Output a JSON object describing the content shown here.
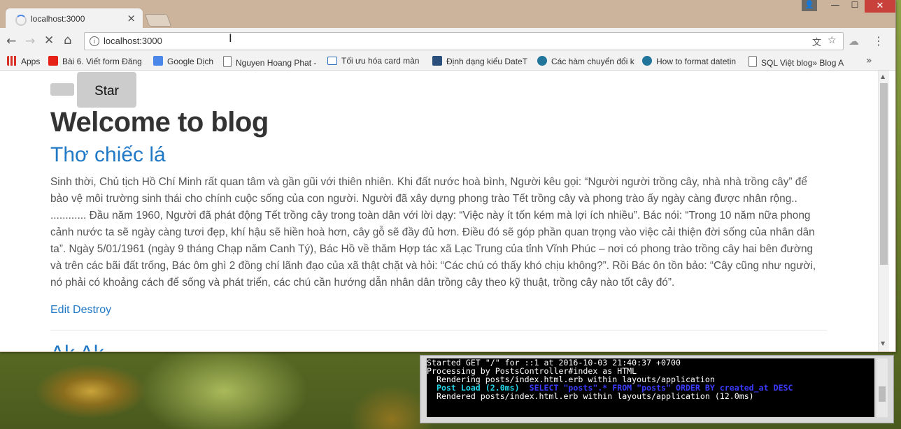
{
  "browser": {
    "tab_title": "localhost:3000",
    "tab_close": "×",
    "url": "localhost:3000",
    "window_controls": {
      "user": "👤",
      "minimize": "—",
      "maximize": "☐",
      "close": "✕"
    }
  },
  "bookmarks": [
    {
      "label": "Apps",
      "icon": "apps-grid-icon",
      "color": "#d93025"
    },
    {
      "label": "Bài 6. Viết form Đăng",
      "icon": "youtube-icon",
      "color": "#e62117"
    },
    {
      "label": "Google Dịch",
      "icon": "google-translate-icon",
      "color": "#4a87e8"
    },
    {
      "label": "Nguyen Hoang Phat -",
      "icon": "page-icon",
      "color": "#777777"
    },
    {
      "label": "Tối ưu hóa card màn",
      "icon": "nq-icon",
      "color": "#2a6ebb"
    },
    {
      "label": "Định dạng kiểu DateT",
      "icon": "v-logo-icon",
      "color": "#2a4f7a"
    },
    {
      "label": "Các hàm chuyển đổi k",
      "icon": "wordpress-icon",
      "color": "#21759b"
    },
    {
      "label": "How to format datetin",
      "icon": "wordpress-icon",
      "color": "#21759b"
    },
    {
      "label": "SQL Việt blog» Blog A",
      "icon": "page-icon",
      "color": "#777777"
    }
  ],
  "bookmarks_more": "»",
  "page": {
    "star_button": "Star",
    "title": "Welcome to blog",
    "post": {
      "title": "Thơ chiếc lá",
      "body": "Sinh thời, Chủ tịch Hồ Chí Minh rất quan tâm và gần gũi với thiên nhiên. Khi đất nước hoà bình, Người kêu gọi: “Người người trồng cây, nhà nhà trồng cây” để bảo vệ môi trường sinh thái cho chính cuộc sống của con người. Người đã xây dựng phong trào Tết trồng cây và phong trào ấy ngày càng được nhân rộng.. ............ Đầu năm 1960, Người đã phát động Tết trồng cây trong toàn dân với lời dạy: “Việc này ít tốn kém mà lợi ích nhiều”. Bác nói: “Trong 10 năm nữa phong cảnh nước ta sẽ ngày càng tươi đẹp, khí hậu sẽ hiền hoà hơn, cây gỗ sẽ đầy đủ hơn. Điều đó sẽ góp phần quan trọng vào việc cải thiện đời sống của nhân dân ta”. Ngày 5/01/1961 (ngày 9 tháng Chạp năm Canh Tý), Bác Hồ về thăm Hợp tác xã Lạc Trung của tỉnh Vĩnh Phúc – nơi có phong trào trồng cây hai bên đường và trên các bãi đất trống, Bác ôm ghì 2 đồng chí lãnh đạo của xã thật chặt và hỏi: “Các chú có thấy khó chịu không?”. Rồi Bác ôn tồn bảo: “Cây cũng như người, nó phải có khoảng cách để sống và phát triển, các chú cần hướng dẫn nhân dân trồng cây theo kỹ thuật, trồng cây nào tốt cây đó”.",
      "edit": "Edit",
      "destroy": "Destroy"
    },
    "next_post_title": "Ak Ak"
  },
  "terminal": {
    "line1": "Started GET \"/\" for ::1 at 2016-10-03 21:40:37 +0700",
    "line2": "Processing by PostsController#index as HTML",
    "line3": "  Rendering posts/index.html.erb within layouts/application",
    "line4_a": "  Post Load (2.0ms)",
    "line4_b": "  SELECT \"posts\".* FROM \"posts\" ORDER BY created_at DESC",
    "line5": "  Rendered posts/index.html.erb within layouts/application (12.0ms)"
  }
}
